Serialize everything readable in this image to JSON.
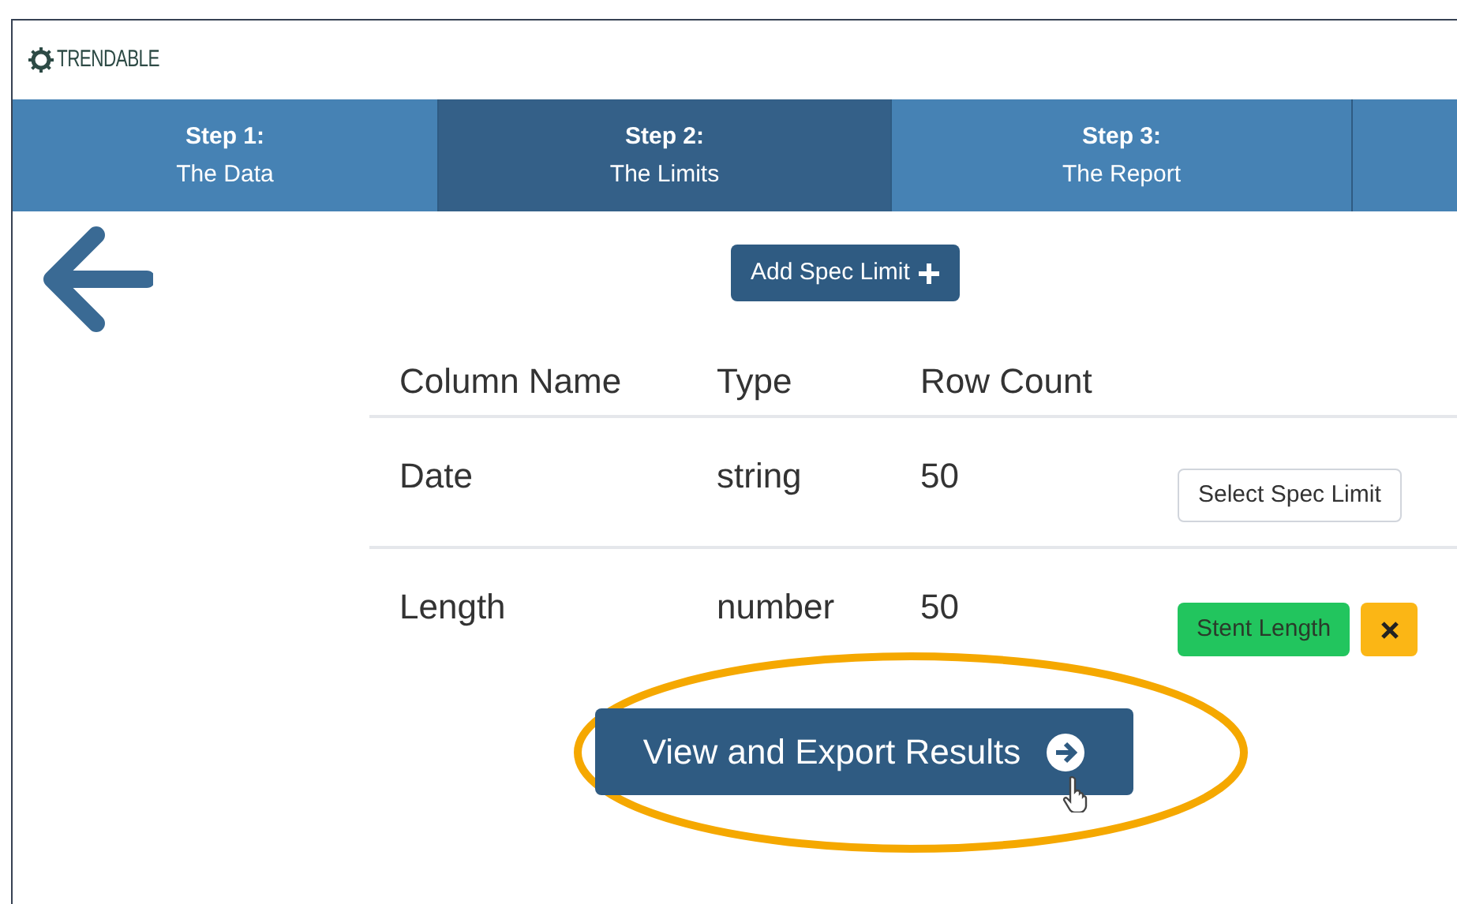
{
  "logo": {
    "text": "TRENDABLE"
  },
  "steps": [
    {
      "label": "Step 1:",
      "sublabel": "The Data",
      "selected": false
    },
    {
      "label": "Step 2:",
      "sublabel": "The Limits",
      "selected": true
    },
    {
      "label": "Step 3:",
      "sublabel": "The Report",
      "selected": false
    }
  ],
  "add_button": {
    "label": "Add Spec Limit"
  },
  "table": {
    "columns": [
      "Column Name",
      "Type",
      "Row Count"
    ],
    "rows": [
      {
        "name": "Date",
        "type": "string",
        "count": "50",
        "action": {
          "kind": "select",
          "label": "Select Spec Limit"
        }
      },
      {
        "name": "Length",
        "type": "number",
        "count": "50",
        "action": {
          "kind": "assigned",
          "label": "Stent Length"
        }
      }
    ]
  },
  "primary_button": {
    "label": "View and Export Results"
  }
}
